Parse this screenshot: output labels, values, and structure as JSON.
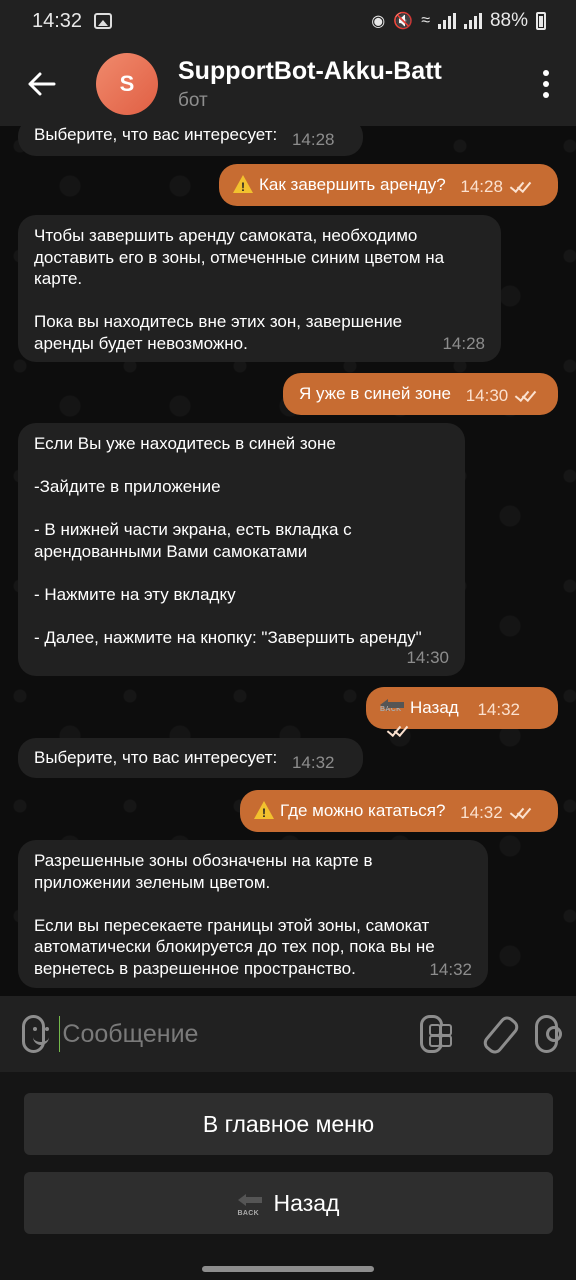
{
  "status_bar": {
    "time": "14:32",
    "battery": "88%",
    "icons": [
      "image-icon",
      "lock-icon",
      "mute-icon",
      "wifi-icon",
      "signal-icon",
      "signal-icon",
      "battery-icon"
    ]
  },
  "header": {
    "avatar_letter": "S",
    "title": "SupportBot-Akku-Batt",
    "subtitle": "бот",
    "accent_color": "#e86a4f"
  },
  "messages": [
    {
      "dir": "in",
      "text": "Выберите, что вас интересует:",
      "time": "14:28"
    },
    {
      "dir": "out",
      "icon": "warning-icon",
      "text": "Как завершить аренду?",
      "time": "14:28"
    },
    {
      "dir": "in",
      "text": "Чтобы завершить аренду самоката, необходимо\nдоставить его в зоны, отмеченные синим цветом на\nкарте.\n\nПока вы находитесь вне этих зон, завершение\nаренды будет невозможно.",
      "time": "14:28"
    },
    {
      "dir": "out",
      "text": "Я уже в синей зоне",
      "time": "14:30"
    },
    {
      "dir": "in",
      "text": "Если Вы уже находитесь в синей зоне\n\n-Зайдите в приложение\n\n- В нижней части экрана, есть вкладка с\nарендованными Вами самокатами\n\n- Нажмите на эту вкладку\n\n- Далее, нажмите на кнопку: \"Завершить аренду\"",
      "time": "14:30"
    },
    {
      "dir": "out",
      "icon": "back-icon",
      "text": "Назад",
      "time": "14:32"
    },
    {
      "dir": "in",
      "text": "Выберите, что вас интересует:",
      "time": "14:32"
    },
    {
      "dir": "out",
      "icon": "warning-icon",
      "text": "Где можно кататься?",
      "time": "14:32"
    },
    {
      "dir": "in",
      "text": "Разрешенные зоны обозначены на карте в\nприложении зеленым цветом.\n\nЕсли вы пересекаете границы этой зоны, самокат\nавтоматически блокируется до тех пор, пока вы не\nвернетесь в разрешенное пространство.",
      "time": "14:32"
    }
  ],
  "input": {
    "placeholder": "Сообщение",
    "value": ""
  },
  "keyboard": {
    "buttons": [
      {
        "label": "В главное меню"
      },
      {
        "label": "Назад",
        "icon": "back-icon"
      }
    ]
  },
  "colors": {
    "outgoing_bubble": "#c76c32",
    "incoming_bubble": "#212121",
    "cursor": "#74b94b"
  }
}
